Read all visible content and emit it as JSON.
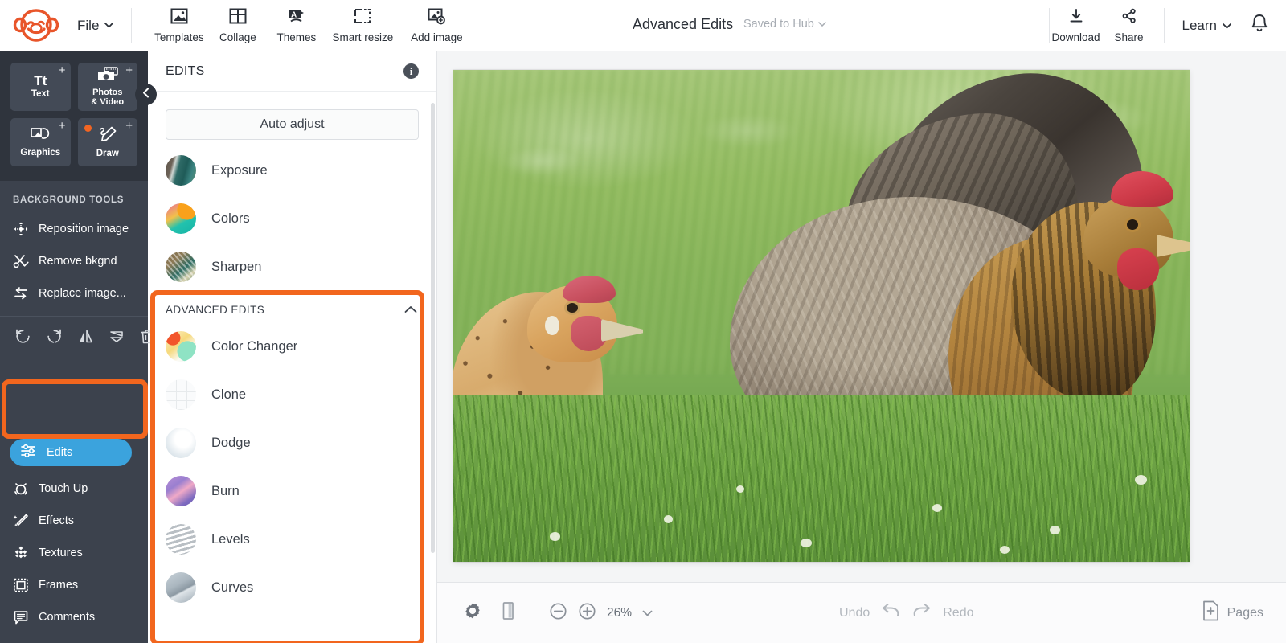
{
  "topbar": {
    "logo_name": "picmonkey-monkey-logo",
    "file_label": "File",
    "tools": [
      {
        "label": "Templates",
        "icon": "templates-icon"
      },
      {
        "label": "Collage",
        "icon": "collage-icon"
      },
      {
        "label": "Themes",
        "icon": "themes-icon"
      },
      {
        "label": "Smart resize",
        "icon": "smart-resize-icon"
      },
      {
        "label": "Add image",
        "icon": "add-image-icon"
      }
    ],
    "doc_title": "Advanced Edits",
    "saved_status": "Saved to Hub",
    "download_label": "Download",
    "share_label": "Share",
    "learn_label": "Learn",
    "bell_icon": "notification-bell-icon"
  },
  "rail": {
    "add_cards": [
      {
        "label": "Text",
        "glyph": "Tt",
        "icon": "text-icon",
        "badge": "+",
        "dot": false
      },
      {
        "label": "Photos\n& Video",
        "line1": "Photos",
        "line2": "& Video",
        "icon": "photos-video-icon",
        "badge": "+",
        "dot": false
      },
      {
        "label": "Graphics",
        "icon": "graphics-icon",
        "badge": "+",
        "dot": false
      },
      {
        "label": "Draw",
        "icon": "draw-icon",
        "badge": "+",
        "dot": true
      }
    ],
    "section_title": "BACKGROUND TOOLS",
    "bg_tools": [
      {
        "label": "Reposition image",
        "icon": "reposition-image-icon"
      },
      {
        "label": "Remove bkgnd",
        "icon": "scissors-icon"
      },
      {
        "label": "Replace image...",
        "icon": "replace-image-icon"
      }
    ],
    "transforms": [
      {
        "icon": "rotate-left-icon"
      },
      {
        "icon": "rotate-right-icon"
      },
      {
        "icon": "flip-horizontal-icon"
      },
      {
        "icon": "flip-vertical-icon"
      },
      {
        "icon": "trash-icon"
      }
    ],
    "nav_items": [
      {
        "label": "Edits",
        "icon": "sliders-icon",
        "active": true
      },
      {
        "label": "Touch Up",
        "icon": "touch-up-icon",
        "active": false
      },
      {
        "label": "Effects",
        "icon": "effects-wand-icon",
        "active": false
      },
      {
        "label": "Textures",
        "icon": "textures-icon",
        "active": false
      },
      {
        "label": "Frames",
        "icon": "frames-icon",
        "active": false
      },
      {
        "label": "Comments",
        "icon": "comments-icon",
        "active": false
      }
    ],
    "collapse_icon": "chevron-left-icon"
  },
  "panel": {
    "title": "EDITS",
    "info_icon": "info-icon",
    "info_glyph": "i",
    "auto_adjust_label": "Auto adjust",
    "basic_edits": [
      {
        "label": "Exposure",
        "thumb": "t-exposure"
      },
      {
        "label": "Colors",
        "thumb": "t-colors"
      },
      {
        "label": "Sharpen",
        "thumb": "t-sharpen"
      }
    ],
    "advanced": {
      "header": "ADVANCED EDITS",
      "chevron_icon": "chevron-up-icon",
      "expanded": true,
      "items": [
        {
          "label": "Color Changer",
          "thumb": "t-colorchanger"
        },
        {
          "label": "Clone",
          "thumb": "t-clone"
        },
        {
          "label": "Dodge",
          "thumb": "t-dodge"
        },
        {
          "label": "Burn",
          "thumb": "t-burn"
        },
        {
          "label": "Levels",
          "thumb": "t-levels"
        },
        {
          "label": "Curves",
          "thumb": "t-curves"
        }
      ]
    }
  },
  "bottombar": {
    "settings_icon": "gear-icon",
    "layout_icon": "panels-icon",
    "zoom_out_icon": "zoom-out-icon",
    "zoom_in_icon": "zoom-in-icon",
    "zoom_value": "26%",
    "zoom_chevron_icon": "chevron-down-icon",
    "undo_label": "Undo",
    "undo_icon": "undo-arrow-icon",
    "redo_label": "Redo",
    "redo_icon": "redo-arrow-icon",
    "pages_label": "Pages",
    "pages_icon": "add-page-icon"
  },
  "canvas": {
    "image_alt": "two-chickens-in-grass-photo"
  },
  "highlights": {
    "accent_color": "#f2661e",
    "boxes": [
      {
        "name": "edits-nav-highlight"
      },
      {
        "name": "advanced-edits-highlight"
      }
    ]
  },
  "colors": {
    "brand_orange": "#e8552a",
    "highlight_orange": "#f2661e",
    "active_blue": "#3ba3dd",
    "rail_dark": "#3c424d",
    "rail_darker": "#2f343d"
  }
}
